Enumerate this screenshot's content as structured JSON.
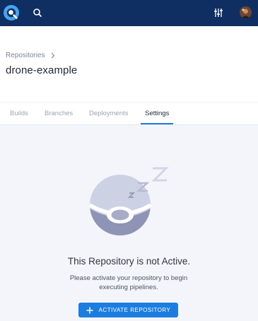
{
  "nav": {
    "logo_icon": "drone-logo-icon",
    "search_icon": "search-icon",
    "settings_icon": "sliders-icon",
    "avatar_icon": "user-avatar-icon"
  },
  "header": {
    "breadcrumb": {
      "label": "Repositories"
    },
    "title": "drone-example"
  },
  "tabs": [
    {
      "label": "Builds"
    },
    {
      "label": "Branches"
    },
    {
      "label": "Deployments"
    },
    {
      "label": "Settings",
      "active": true
    }
  ],
  "empty_state": {
    "illustration_icon": "sleeping-drone-icon",
    "title": "This Repository is not Active.",
    "description": "Please activate your repository to begin executing pipelines.",
    "button_label": "ACTIVATE REPOSITORY",
    "button_icon": "plus-icon"
  },
  "colors": {
    "topbar": "#0f2f63",
    "accent": "#1b7de0",
    "logo": "#45a5f0"
  }
}
